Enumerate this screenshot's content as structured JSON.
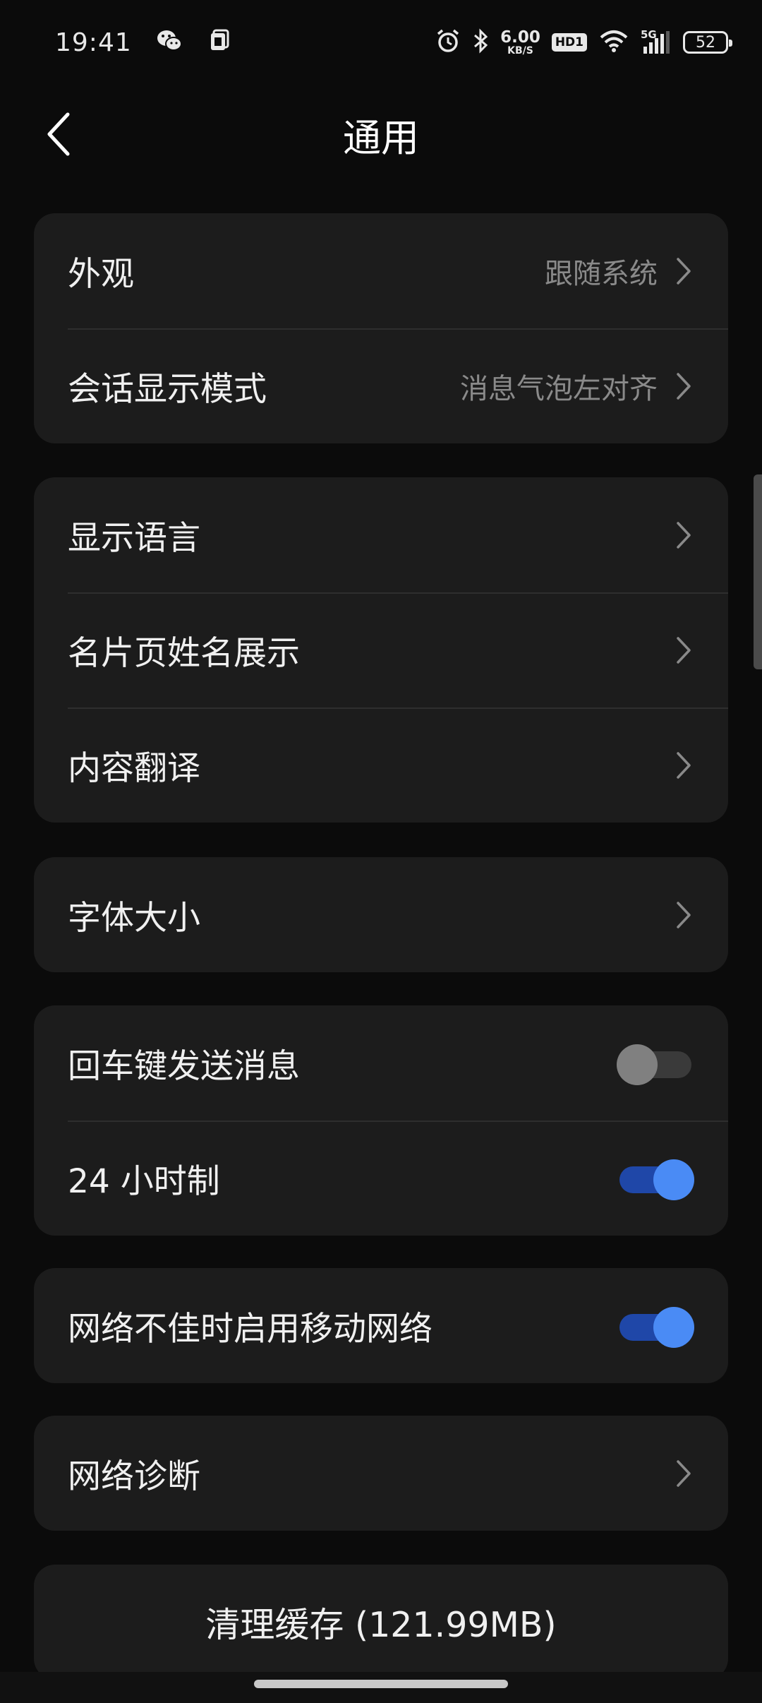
{
  "status_bar": {
    "time": "19:41",
    "speed_value": "6.00",
    "speed_unit": "KB/S",
    "hd_label": "HD1",
    "network_label": "5G",
    "battery_level": "52"
  },
  "header": {
    "title": "通用"
  },
  "sections": {
    "appearance": {
      "label": "外观",
      "value": "跟随系统"
    },
    "chat_mode": {
      "label": "会话显示模式",
      "value": "消息气泡左对齐"
    },
    "display_language": {
      "label": "显示语言"
    },
    "card_name_display": {
      "label": "名片页姓名展示"
    },
    "content_translation": {
      "label": "内容翻译"
    },
    "font_size": {
      "label": "字体大小"
    },
    "enter_to_send": {
      "label": "回车键发送消息",
      "enabled": false
    },
    "time_24h": {
      "label": "24 小时制",
      "enabled": true
    },
    "mobile_network_fallback": {
      "label": "网络不佳时启用移动网络",
      "enabled": true
    },
    "network_diagnosis": {
      "label": "网络诊断"
    },
    "clear_cache": {
      "label": "清理缓存 (121.99MB)"
    }
  },
  "colors": {
    "background": "#0b0b0b",
    "card": "#1c1c1c",
    "toggle_on_knob": "#4a8bf5",
    "toggle_on_track": "#1f47a8",
    "toggle_off_knob": "#808080",
    "secondary_text": "#8a8a8a"
  },
  "icons": [
    "wechat-icon",
    "phone-clipboard-icon",
    "alarm-icon",
    "bluetooth-icon",
    "wifi-icon",
    "signal-icon",
    "battery-icon",
    "back-arrow-icon",
    "chevron-right-icon"
  ]
}
